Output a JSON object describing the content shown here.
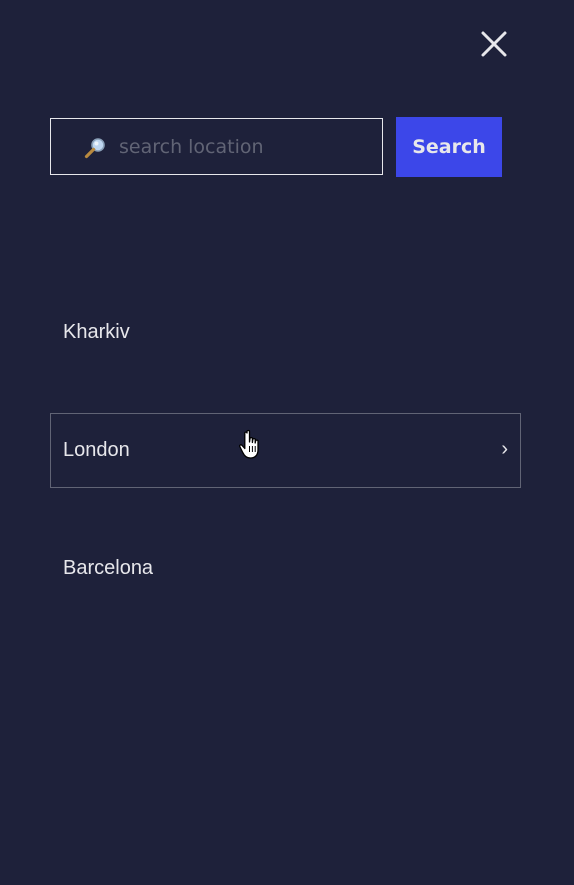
{
  "panel": {
    "close_icon": "close-icon"
  },
  "search": {
    "placeholder": "search location",
    "value": "",
    "icon": "magnifier-icon",
    "button_label": "Search"
  },
  "locations": [
    {
      "label": "Kharkiv",
      "hovered": false
    },
    {
      "label": "London",
      "hovered": true,
      "chevron": "›"
    },
    {
      "label": "Barcelona",
      "hovered": false
    }
  ],
  "colors": {
    "background": "#1e213a",
    "accent": "#3c47e9",
    "text": "#e7e7eb",
    "muted": "#616475"
  }
}
